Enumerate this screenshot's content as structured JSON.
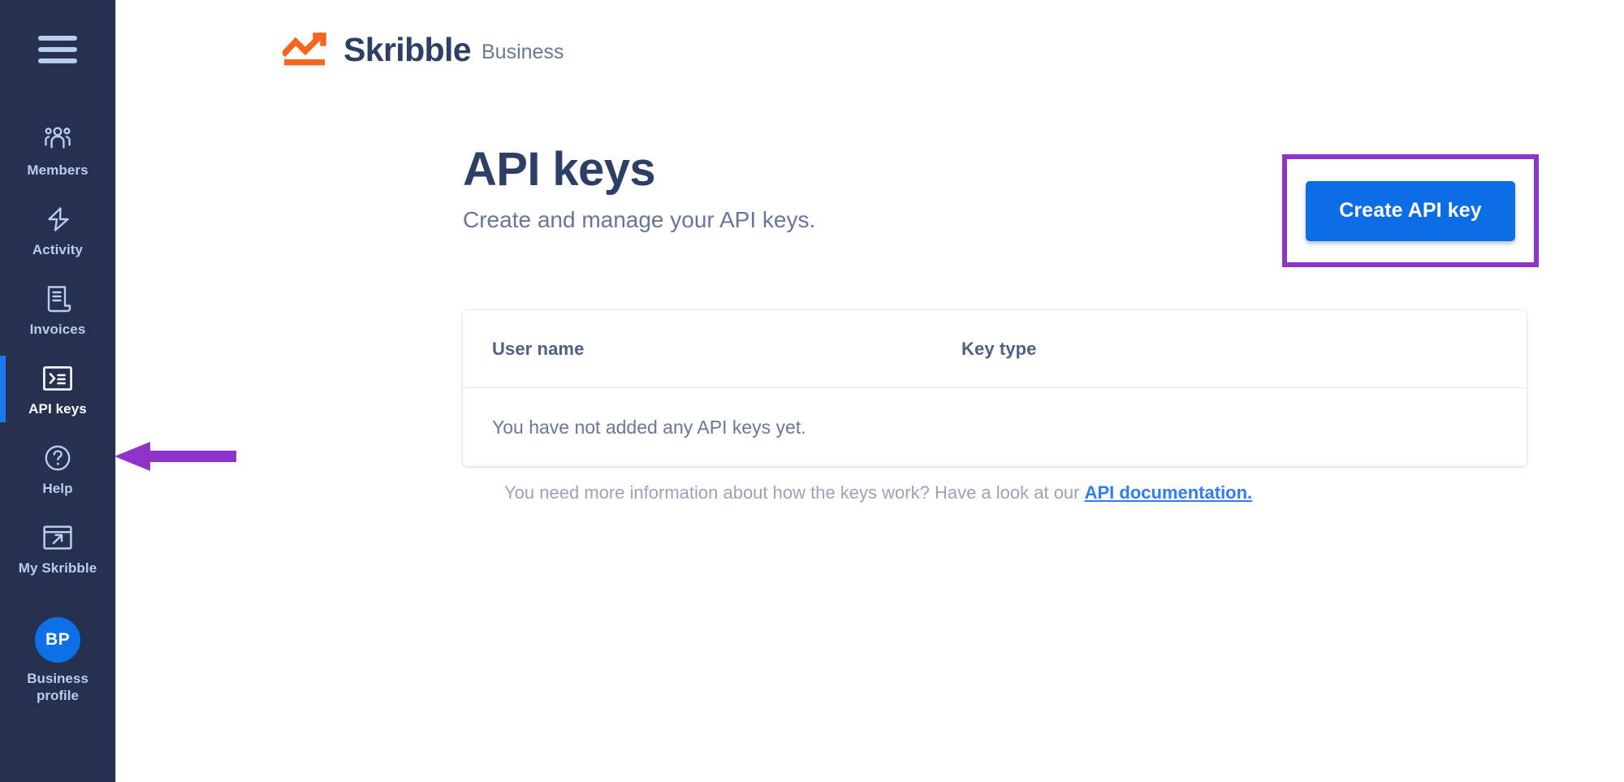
{
  "sidebar": {
    "menu_icon": "hamburger-menu-icon",
    "items": [
      {
        "label": "Members",
        "icon": "members-group-icon",
        "active": false
      },
      {
        "label": "Activity",
        "icon": "lightning-bolt-icon",
        "active": false
      },
      {
        "label": "Invoices",
        "icon": "invoice-document-icon",
        "active": false
      },
      {
        "label": "API keys",
        "icon": "terminal-console-icon",
        "active": true
      },
      {
        "label": "Help",
        "icon": "question-circle-icon",
        "active": false
      },
      {
        "label": "My Skribble",
        "icon": "external-link-window-icon",
        "active": false
      }
    ],
    "profile": {
      "initials": "BP",
      "label": "Business profile"
    },
    "background_color": "#25314f",
    "active_indicator_color": "#1a7aee",
    "label_color": "#b8cdf0"
  },
  "brand": {
    "name": "Skribble",
    "suffix": "Business",
    "mark_icon": "skribble-chart-logo-icon",
    "mark_color": "#f4661e",
    "name_color": "#2c3f66"
  },
  "page": {
    "title": "API keys",
    "subtitle": "Create and manage your API keys."
  },
  "cta": {
    "label": "Create API key",
    "color": "#0c6de4",
    "highlight_color": "#8e34c9"
  },
  "table": {
    "columns": [
      "User name",
      "Key type"
    ],
    "empty_message": "You have not added any API keys yet.",
    "rows": []
  },
  "helper": {
    "text": "You need more information about how the keys work? Have a look at our ",
    "link_label": "API documentation.",
    "link_color": "#2f7df0"
  },
  "annotations": {
    "arrow": {
      "icon": "left-pointing-arrow",
      "color": "#8e34c9",
      "points_to": "sidebar-item-api-keys"
    },
    "box": {
      "color": "#8e34c9",
      "surrounds": "create-api-key-button"
    }
  }
}
